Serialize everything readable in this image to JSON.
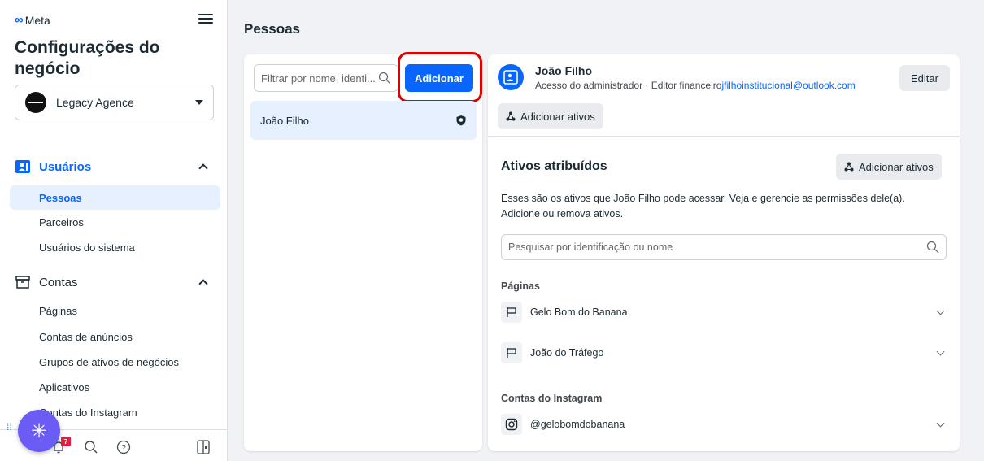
{
  "sidebar": {
    "logo_text": "Meta",
    "app_title": "Configurações do negócio",
    "business": "Legacy Agence",
    "users_section": "Usuários",
    "users_items": [
      "Pessoas",
      "Parceiros",
      "Usuários do sistema"
    ],
    "accounts_section": "Contas",
    "accounts_items": [
      "Páginas",
      "Contas de anúncios",
      "Grupos de ativos de negócios",
      "Aplicativos",
      "Contas do Instagram"
    ],
    "notification_count": "7"
  },
  "main": {
    "page_title": "Pessoas",
    "filter_placeholder": "Filtrar por nome, identi...",
    "add_button": "Adicionar",
    "people": [
      {
        "name": "João Filho"
      }
    ]
  },
  "detail": {
    "user_name": "João Filho",
    "role_text": "Acesso do administrador · Editor financeiro",
    "email": "jfilhoinstitucional@outlook.com",
    "edit_button": "Editar",
    "add_assets_button": "Adicionar ativos",
    "assets_title": "Ativos atribuídos",
    "assets_add_button": "Adicionar ativos",
    "assets_description": "Esses são os ativos que João Filho pode acessar. Veja e gerencie as permissões dele(a). Adicione ou remova ativos.",
    "search_placeholder": "Pesquisar por identificação ou nome",
    "pages_label": "Páginas",
    "pages": [
      "Gelo Bom do Banana",
      "João do Tráfego"
    ],
    "instagram_label": "Contas do Instagram",
    "instagram": [
      "@gelobomdobanana"
    ]
  },
  "colors": {
    "accent": "#0866ff",
    "annotation": "#e00000",
    "fab": "#6b5cf6"
  }
}
